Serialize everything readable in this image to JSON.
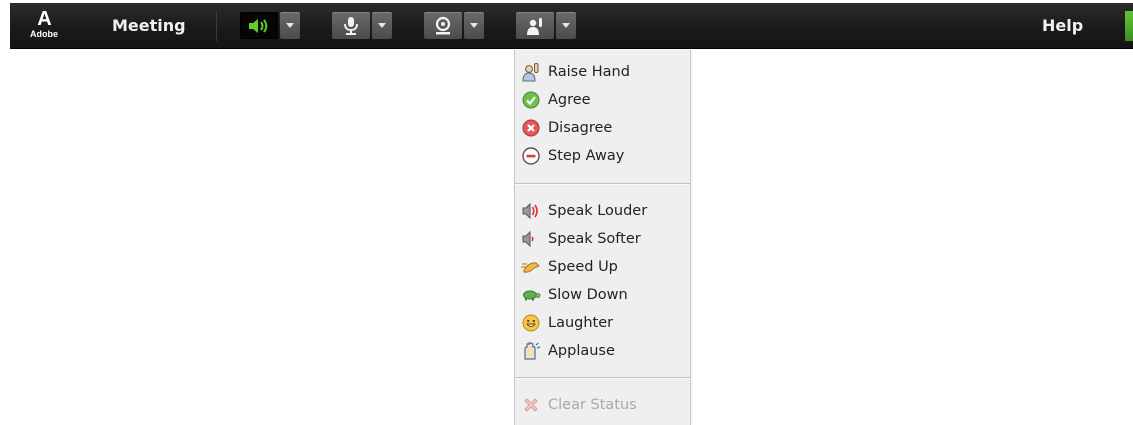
{
  "logo": {
    "mark": "A",
    "word": "Adobe"
  },
  "menubar": {
    "meeting": "Meeting",
    "help": "Help"
  },
  "toolbar": {
    "speaker_icon": "speaker-on-icon",
    "mic_icon": "microphone-icon",
    "camera_icon": "webcam-icon",
    "status_icon": "raise-hand-icon",
    "speaker_active_color": "#5fce2d"
  },
  "status_menu": {
    "group1": [
      {
        "label": "Raise Hand",
        "icon": "raise-hand-icon"
      },
      {
        "label": "Agree",
        "icon": "agree-check-icon"
      },
      {
        "label": "Disagree",
        "icon": "disagree-x-icon"
      },
      {
        "label": "Step Away",
        "icon": "step-away-icon"
      }
    ],
    "group2": [
      {
        "label": "Speak Louder",
        "icon": "speak-louder-icon"
      },
      {
        "label": "Speak Softer",
        "icon": "speak-softer-icon"
      },
      {
        "label": "Speed Up",
        "icon": "speed-up-icon"
      },
      {
        "label": "Slow Down",
        "icon": "slow-down-turtle-icon"
      },
      {
        "label": "Laughter",
        "icon": "laughter-smiley-icon"
      },
      {
        "label": "Applause",
        "icon": "applause-icon"
      }
    ],
    "clear": {
      "label": "Clear Status",
      "icon": "clear-status-icon",
      "disabled": true
    }
  }
}
